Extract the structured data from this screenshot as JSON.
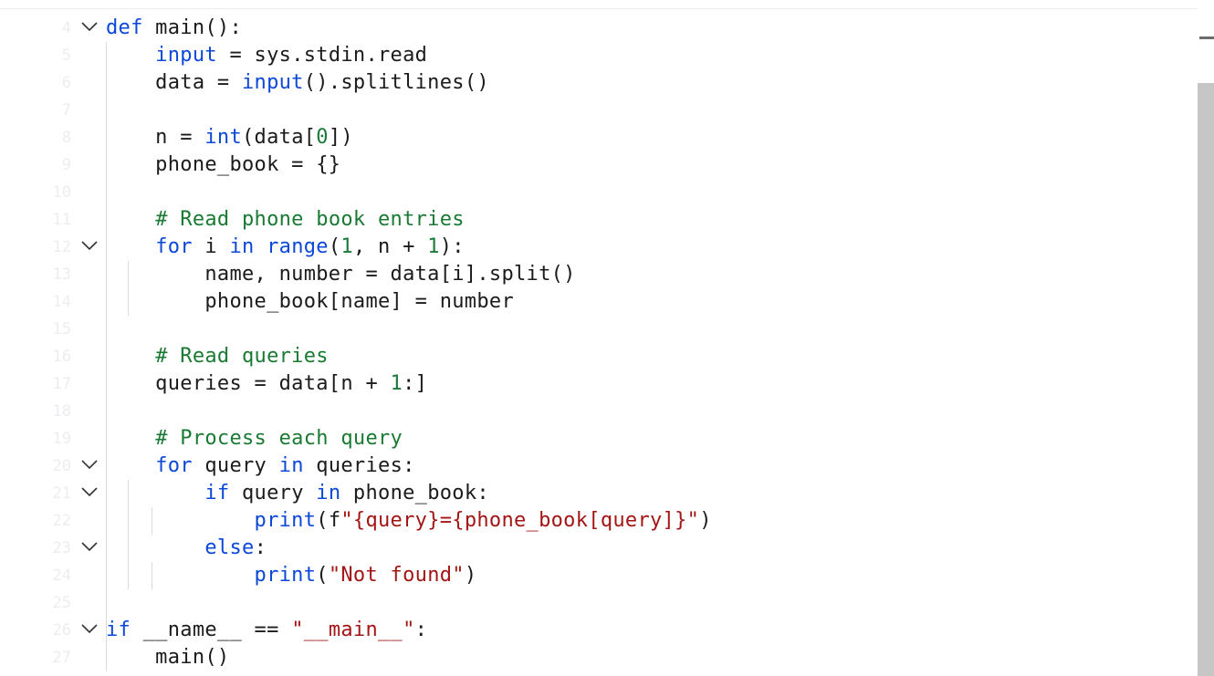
{
  "editor": {
    "lines": [
      {
        "n": "4",
        "fold": true,
        "tokens": [
          [
            "kw",
            "def"
          ],
          [
            "fn",
            " main():"
          ]
        ]
      },
      {
        "n": "5",
        "fold": false,
        "tokens": [
          [
            "fn",
            "    "
          ],
          [
            "kw",
            "input"
          ],
          [
            "fn",
            " = sys.stdin.read"
          ]
        ]
      },
      {
        "n": "6",
        "fold": false,
        "tokens": [
          [
            "fn",
            "    data = "
          ],
          [
            "kw",
            "input"
          ],
          [
            "fn",
            "().splitlines()"
          ]
        ]
      },
      {
        "n": "7",
        "fold": false,
        "tokens": []
      },
      {
        "n": "8",
        "fold": false,
        "tokens": [
          [
            "fn",
            "    n = "
          ],
          [
            "kw",
            "int"
          ],
          [
            "fn",
            "(data["
          ],
          [
            "num",
            "0"
          ],
          [
            "fn",
            "])"
          ]
        ]
      },
      {
        "n": "9",
        "fold": false,
        "tokens": [
          [
            "fn",
            "    phone_book = {}"
          ]
        ]
      },
      {
        "n": "10",
        "fold": false,
        "tokens": []
      },
      {
        "n": "11",
        "fold": false,
        "tokens": [
          [
            "fn",
            "    "
          ],
          [
            "cm",
            "# Read phone book entries"
          ]
        ]
      },
      {
        "n": "12",
        "fold": true,
        "tokens": [
          [
            "fn",
            "    "
          ],
          [
            "kw",
            "for"
          ],
          [
            "fn",
            " i "
          ],
          [
            "kw",
            "in"
          ],
          [
            "fn",
            " "
          ],
          [
            "kw",
            "range"
          ],
          [
            "fn",
            "("
          ],
          [
            "num",
            "1"
          ],
          [
            "fn",
            ", n + "
          ],
          [
            "num",
            "1"
          ],
          [
            "fn",
            "):"
          ]
        ]
      },
      {
        "n": "13",
        "fold": false,
        "tokens": [
          [
            "fn",
            "        name, number = data[i].split()"
          ]
        ]
      },
      {
        "n": "14",
        "fold": false,
        "tokens": [
          [
            "fn",
            "        phone_book[name] = number"
          ]
        ]
      },
      {
        "n": "15",
        "fold": false,
        "tokens": []
      },
      {
        "n": "16",
        "fold": false,
        "tokens": [
          [
            "fn",
            "    "
          ],
          [
            "cm",
            "# Read queries"
          ]
        ]
      },
      {
        "n": "17",
        "fold": false,
        "tokens": [
          [
            "fn",
            "    queries = data[n + "
          ],
          [
            "num",
            "1"
          ],
          [
            "fn",
            ":]"
          ]
        ]
      },
      {
        "n": "18",
        "fold": false,
        "tokens": []
      },
      {
        "n": "19",
        "fold": false,
        "tokens": [
          [
            "fn",
            "    "
          ],
          [
            "cm",
            "# Process each query"
          ]
        ]
      },
      {
        "n": "20",
        "fold": true,
        "tokens": [
          [
            "fn",
            "    "
          ],
          [
            "kw",
            "for"
          ],
          [
            "fn",
            " query "
          ],
          [
            "kw",
            "in"
          ],
          [
            "fn",
            " queries:"
          ]
        ]
      },
      {
        "n": "21",
        "fold": true,
        "tokens": [
          [
            "fn",
            "        "
          ],
          [
            "kw",
            "if"
          ],
          [
            "fn",
            " query "
          ],
          [
            "kw",
            "in"
          ],
          [
            "fn",
            " phone_book:"
          ]
        ]
      },
      {
        "n": "22",
        "fold": false,
        "tokens": [
          [
            "fn",
            "            "
          ],
          [
            "kw",
            "print"
          ],
          [
            "fn",
            "(f"
          ],
          [
            "str",
            "\"{query}={phone_book[query]}\""
          ],
          [
            "fn",
            ")"
          ]
        ]
      },
      {
        "n": "23",
        "fold": true,
        "tokens": [
          [
            "fn",
            "        "
          ],
          [
            "kw",
            "else"
          ],
          [
            "fn",
            ":"
          ]
        ]
      },
      {
        "n": "24",
        "fold": false,
        "tokens": [
          [
            "fn",
            "            "
          ],
          [
            "kw",
            "print"
          ],
          [
            "fn",
            "("
          ],
          [
            "str",
            "\"Not found\""
          ],
          [
            "fn",
            ")"
          ]
        ]
      },
      {
        "n": "25",
        "fold": false,
        "tokens": []
      },
      {
        "n": "26",
        "fold": true,
        "tokens": [
          [
            "kw",
            "if"
          ],
          [
            "fn",
            " __name__ == "
          ],
          [
            "str",
            "\"__main__\""
          ],
          [
            "fn",
            ":"
          ]
        ]
      },
      {
        "n": "27",
        "fold": false,
        "tokens": [
          [
            "fn",
            "    main()"
          ]
        ]
      }
    ]
  },
  "icons": {
    "fold": "chevron-down-icon"
  },
  "colors": {
    "keyword": "#0b47d8",
    "string": "#a31515",
    "number": "#1b7a3a",
    "comment": "#1a7a33",
    "line_number": "#ecedf0",
    "scroll_thumb": "#c6c6c6"
  }
}
